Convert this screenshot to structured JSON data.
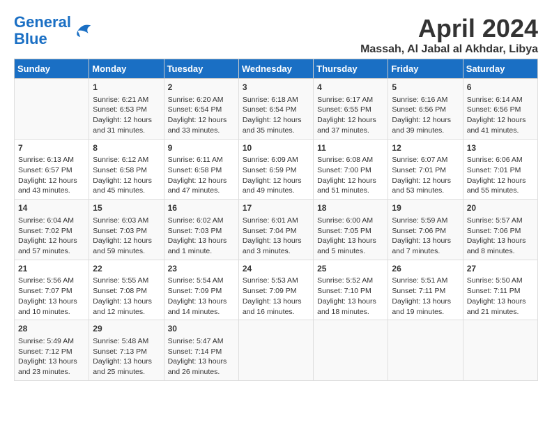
{
  "header": {
    "logo_line1": "General",
    "logo_line2": "Blue",
    "title": "April 2024",
    "subtitle": "Massah, Al Jabal al Akhdar, Libya"
  },
  "columns": [
    "Sunday",
    "Monday",
    "Tuesday",
    "Wednesday",
    "Thursday",
    "Friday",
    "Saturday"
  ],
  "weeks": [
    [
      {
        "day": "",
        "content": ""
      },
      {
        "day": "1",
        "content": "Sunrise: 6:21 AM\nSunset: 6:53 PM\nDaylight: 12 hours\nand 31 minutes."
      },
      {
        "day": "2",
        "content": "Sunrise: 6:20 AM\nSunset: 6:54 PM\nDaylight: 12 hours\nand 33 minutes."
      },
      {
        "day": "3",
        "content": "Sunrise: 6:18 AM\nSunset: 6:54 PM\nDaylight: 12 hours\nand 35 minutes."
      },
      {
        "day": "4",
        "content": "Sunrise: 6:17 AM\nSunset: 6:55 PM\nDaylight: 12 hours\nand 37 minutes."
      },
      {
        "day": "5",
        "content": "Sunrise: 6:16 AM\nSunset: 6:56 PM\nDaylight: 12 hours\nand 39 minutes."
      },
      {
        "day": "6",
        "content": "Sunrise: 6:14 AM\nSunset: 6:56 PM\nDaylight: 12 hours\nand 41 minutes."
      }
    ],
    [
      {
        "day": "7",
        "content": "Sunrise: 6:13 AM\nSunset: 6:57 PM\nDaylight: 12 hours\nand 43 minutes."
      },
      {
        "day": "8",
        "content": "Sunrise: 6:12 AM\nSunset: 6:58 PM\nDaylight: 12 hours\nand 45 minutes."
      },
      {
        "day": "9",
        "content": "Sunrise: 6:11 AM\nSunset: 6:58 PM\nDaylight: 12 hours\nand 47 minutes."
      },
      {
        "day": "10",
        "content": "Sunrise: 6:09 AM\nSunset: 6:59 PM\nDaylight: 12 hours\nand 49 minutes."
      },
      {
        "day": "11",
        "content": "Sunrise: 6:08 AM\nSunset: 7:00 PM\nDaylight: 12 hours\nand 51 minutes."
      },
      {
        "day": "12",
        "content": "Sunrise: 6:07 AM\nSunset: 7:01 PM\nDaylight: 12 hours\nand 53 minutes."
      },
      {
        "day": "13",
        "content": "Sunrise: 6:06 AM\nSunset: 7:01 PM\nDaylight: 12 hours\nand 55 minutes."
      }
    ],
    [
      {
        "day": "14",
        "content": "Sunrise: 6:04 AM\nSunset: 7:02 PM\nDaylight: 12 hours\nand 57 minutes."
      },
      {
        "day": "15",
        "content": "Sunrise: 6:03 AM\nSunset: 7:03 PM\nDaylight: 12 hours\nand 59 minutes."
      },
      {
        "day": "16",
        "content": "Sunrise: 6:02 AM\nSunset: 7:03 PM\nDaylight: 13 hours\nand 1 minute."
      },
      {
        "day": "17",
        "content": "Sunrise: 6:01 AM\nSunset: 7:04 PM\nDaylight: 13 hours\nand 3 minutes."
      },
      {
        "day": "18",
        "content": "Sunrise: 6:00 AM\nSunset: 7:05 PM\nDaylight: 13 hours\nand 5 minutes."
      },
      {
        "day": "19",
        "content": "Sunrise: 5:59 AM\nSunset: 7:06 PM\nDaylight: 13 hours\nand 7 minutes."
      },
      {
        "day": "20",
        "content": "Sunrise: 5:57 AM\nSunset: 7:06 PM\nDaylight: 13 hours\nand 8 minutes."
      }
    ],
    [
      {
        "day": "21",
        "content": "Sunrise: 5:56 AM\nSunset: 7:07 PM\nDaylight: 13 hours\nand 10 minutes."
      },
      {
        "day": "22",
        "content": "Sunrise: 5:55 AM\nSunset: 7:08 PM\nDaylight: 13 hours\nand 12 minutes."
      },
      {
        "day": "23",
        "content": "Sunrise: 5:54 AM\nSunset: 7:09 PM\nDaylight: 13 hours\nand 14 minutes."
      },
      {
        "day": "24",
        "content": "Sunrise: 5:53 AM\nSunset: 7:09 PM\nDaylight: 13 hours\nand 16 minutes."
      },
      {
        "day": "25",
        "content": "Sunrise: 5:52 AM\nSunset: 7:10 PM\nDaylight: 13 hours\nand 18 minutes."
      },
      {
        "day": "26",
        "content": "Sunrise: 5:51 AM\nSunset: 7:11 PM\nDaylight: 13 hours\nand 19 minutes."
      },
      {
        "day": "27",
        "content": "Sunrise: 5:50 AM\nSunset: 7:11 PM\nDaylight: 13 hours\nand 21 minutes."
      }
    ],
    [
      {
        "day": "28",
        "content": "Sunrise: 5:49 AM\nSunset: 7:12 PM\nDaylight: 13 hours\nand 23 minutes."
      },
      {
        "day": "29",
        "content": "Sunrise: 5:48 AM\nSunset: 7:13 PM\nDaylight: 13 hours\nand 25 minutes."
      },
      {
        "day": "30",
        "content": "Sunrise: 5:47 AM\nSunset: 7:14 PM\nDaylight: 13 hours\nand 26 minutes."
      },
      {
        "day": "",
        "content": ""
      },
      {
        "day": "",
        "content": ""
      },
      {
        "day": "",
        "content": ""
      },
      {
        "day": "",
        "content": ""
      }
    ]
  ]
}
